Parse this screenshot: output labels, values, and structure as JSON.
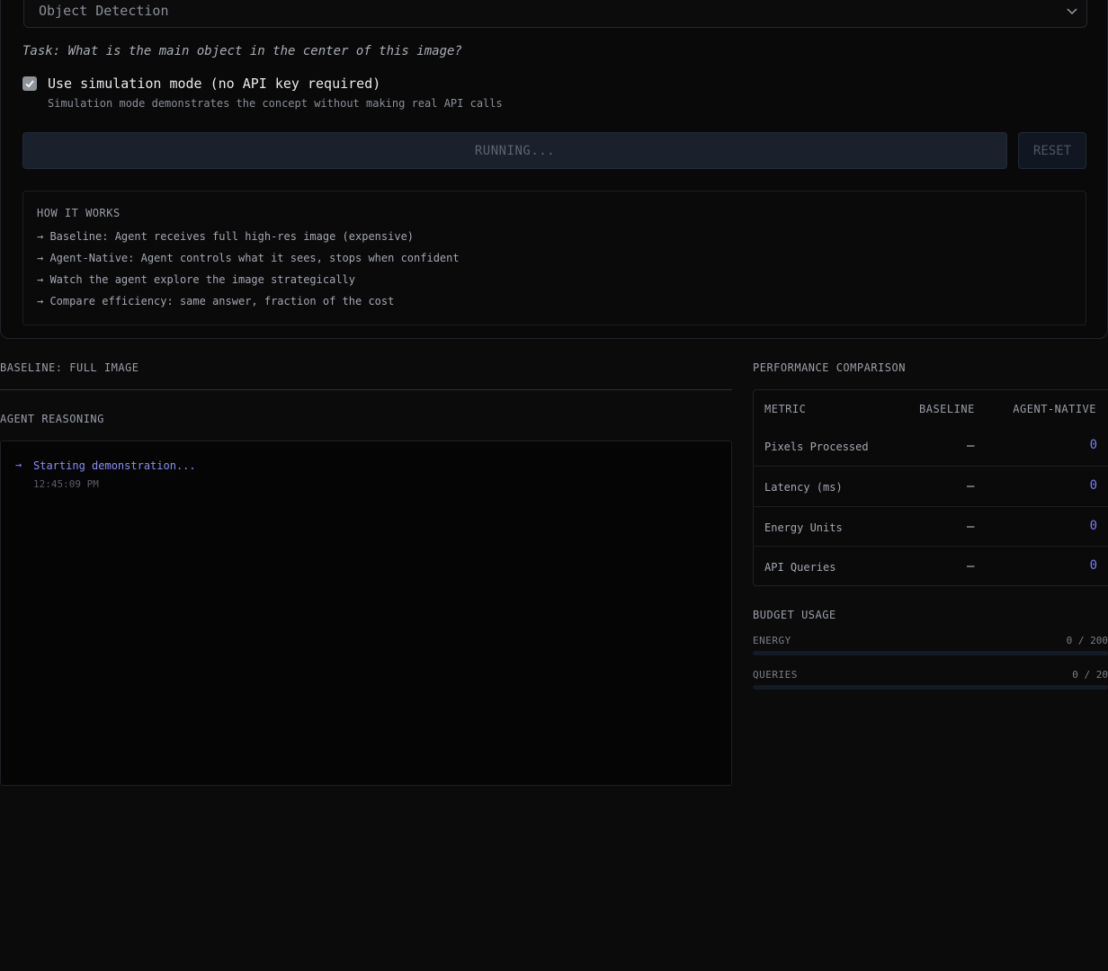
{
  "config": {
    "mode_select": {
      "value": "Object Detection"
    },
    "task": "Task: What is the main object in the center of this image?",
    "simulation": {
      "checked": true,
      "label": "Use simulation mode (no API key required)",
      "hint": "Simulation mode demonstrates the concept without making real API calls"
    },
    "run_button": "RUNNING...",
    "reset_button": "RESET",
    "how_it_works": {
      "title": "HOW IT WORKS",
      "lines": [
        "→ Baseline: Agent receives full high-res image (expensive)",
        "→ Agent-Native: Agent controls what it sees, stops when confident",
        "→ Watch the agent explore the image strategically",
        "→ Compare efficiency: same answer, fraction of the cost"
      ]
    }
  },
  "baseline": {
    "title": "BASELINE: FULL IMAGE"
  },
  "reasoning": {
    "title": "AGENT REASONING",
    "log": [
      {
        "arrow": "→",
        "message": "Starting demonstration...",
        "time": "12:45:09 PM"
      }
    ]
  },
  "performance": {
    "title": "PERFORMANCE COMPARISON",
    "headers": {
      "metric": "METRIC",
      "baseline": "BASELINE",
      "agent": "AGENT-NATIVE"
    },
    "rows": [
      {
        "metric": "Pixels Processed",
        "baseline": "–",
        "agent": "0"
      },
      {
        "metric": "Latency (ms)",
        "baseline": "–",
        "agent": "0"
      },
      {
        "metric": "Energy Units",
        "baseline": "–",
        "agent": "0"
      },
      {
        "metric": "API Queries",
        "baseline": "–",
        "agent": "0"
      }
    ]
  },
  "budget": {
    "title": "BUDGET USAGE",
    "items": [
      {
        "label": "ENERGY",
        "value": "0 / 200",
        "fraction": 0
      },
      {
        "label": "QUERIES",
        "value": "0 / 20",
        "fraction": 0
      }
    ]
  },
  "colors": {
    "accent": "#7b7ff0",
    "background": "#0b0b0c"
  }
}
